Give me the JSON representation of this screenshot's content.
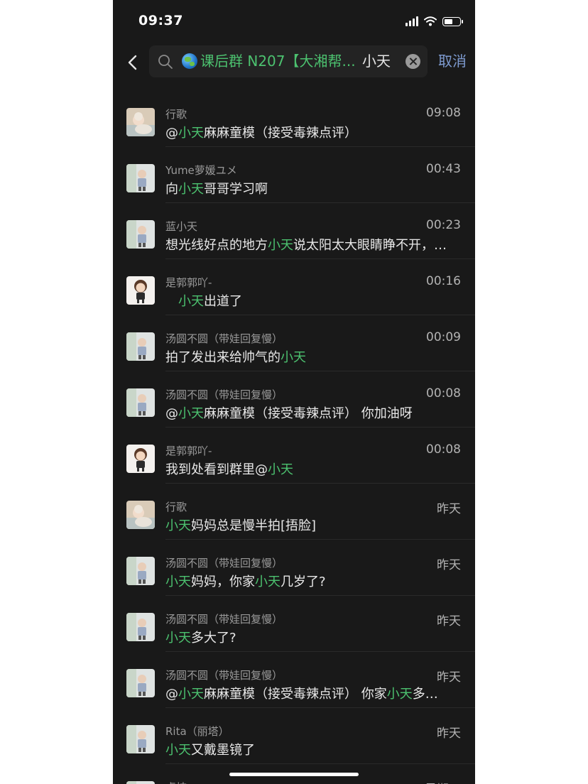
{
  "status_bar": {
    "time": "09:37"
  },
  "search": {
    "chip_text": "课后群 N207【大湘帮...",
    "query": "小天",
    "cancel_label": "取消"
  },
  "highlight_term": "小天",
  "colors": {
    "highlight": "#4cc16f",
    "background": "#191919",
    "cancel": "#7e9bd0"
  },
  "results": [
    {
      "name": "行歌",
      "time": "09:08",
      "message": "@小天麻麻童模（接受毒辣点评）",
      "avatar": "baby-photo"
    },
    {
      "name": "Yume萝媛ユメ",
      "time": "00:43",
      "message": "向小天哥哥学习啊",
      "avatar": "child-photo"
    },
    {
      "name": "蓝小天",
      "time": "00:23",
      "message": "想光线好点的地方小天说太阳太大眼睛睁不开，…",
      "avatar": "child-photo"
    },
    {
      "name": "是郭郭吖-",
      "time": "00:16",
      "message": "　小天出道了",
      "avatar": "cartoon-boy"
    },
    {
      "name": "汤圆不圆（带娃回复慢）",
      "time": "00:09",
      "message": "拍了发出来给帅气的小天",
      "avatar": "child-photo"
    },
    {
      "name": "汤圆不圆（带娃回复慢）",
      "time": "00:08",
      "message": "@小天麻麻童模（接受毒辣点评） 你加油呀",
      "avatar": "child-photo"
    },
    {
      "name": "是郭郭吖-",
      "time": "00:08",
      "message": "我到处看到群里@小天",
      "avatar": "cartoon-boy"
    },
    {
      "name": "行歌",
      "time": "昨天",
      "message": "小天妈妈总是慢半拍[捂脸]",
      "avatar": "baby-photo"
    },
    {
      "name": "汤圆不圆（带娃回复慢）",
      "time": "昨天",
      "message": "小天妈妈，你家小天几岁了?",
      "avatar": "child-photo"
    },
    {
      "name": "汤圆不圆（带娃回复慢）",
      "time": "昨天",
      "message": "小天多大了?",
      "avatar": "child-photo"
    },
    {
      "name": "汤圆不圆（带娃回复慢）",
      "time": "昨天",
      "message": "@小天麻麻童模（接受毒辣点评） 你家小天多…",
      "avatar": "child-photo"
    },
    {
      "name": "Rita（丽塔）",
      "time": "昨天",
      "message": "小天又戴墨镜了",
      "avatar": "child-photo"
    },
    {
      "name": "卓桔",
      "time": "星期五",
      "message": "",
      "avatar": "child-photo"
    }
  ]
}
